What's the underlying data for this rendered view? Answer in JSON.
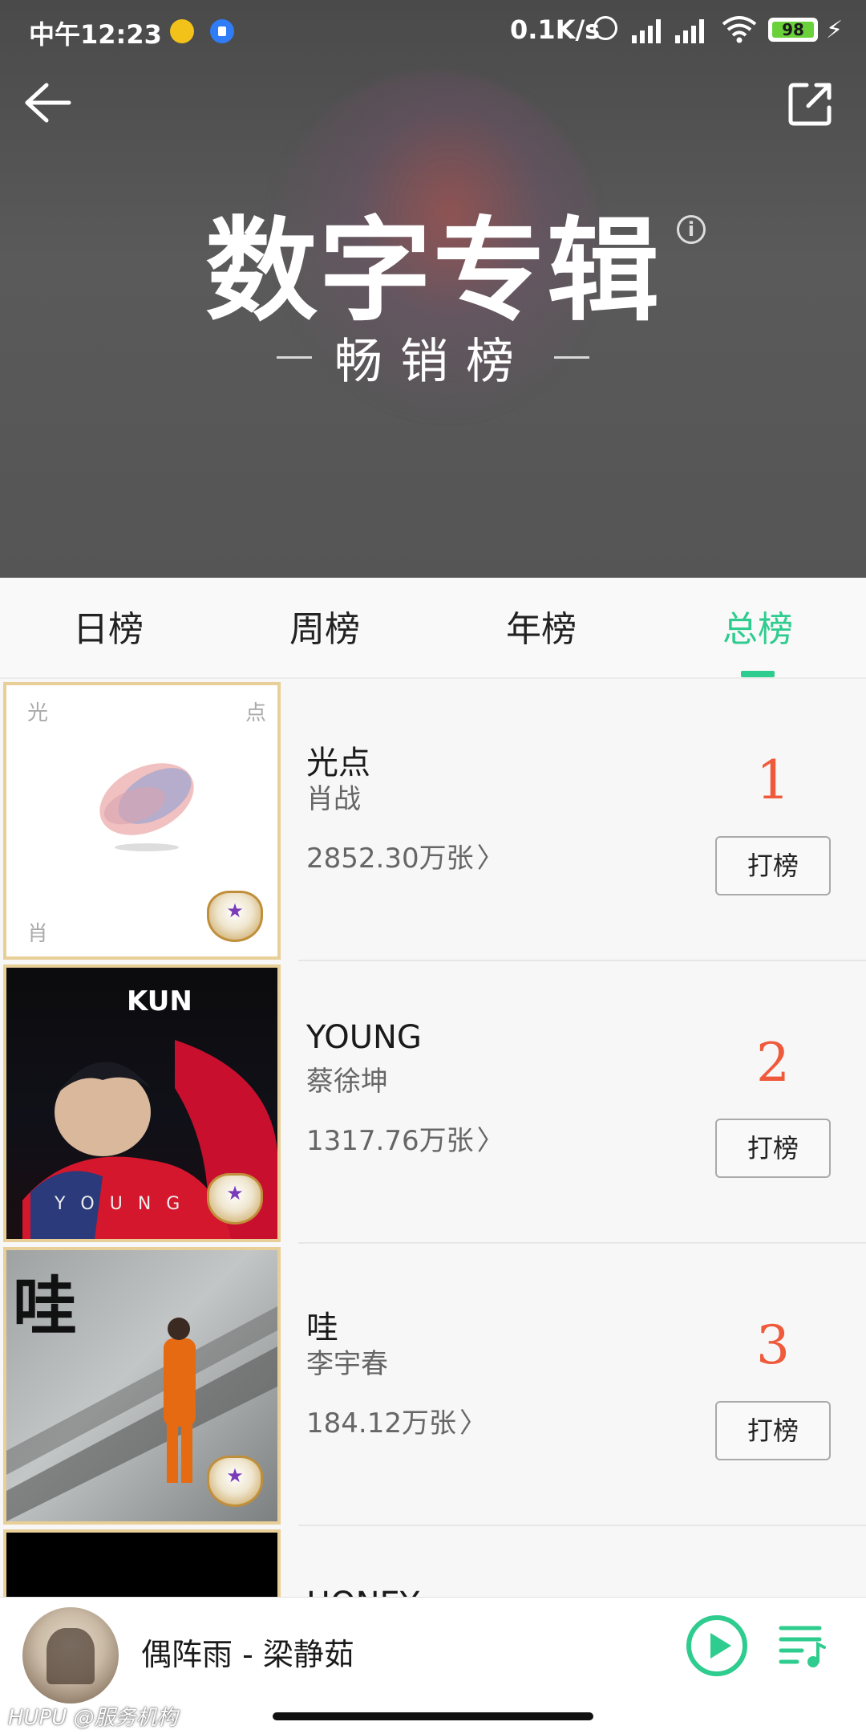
{
  "status": {
    "time": "中午12:23",
    "net_speed": "0.1K/s",
    "battery": "98"
  },
  "header": {
    "title": "数字专辑",
    "subtitle": "畅销榜",
    "info_symbol": "i"
  },
  "tabs": [
    {
      "label": "日榜",
      "active": false
    },
    {
      "label": "周榜",
      "active": false
    },
    {
      "label": "年榜",
      "active": false
    },
    {
      "label": "总榜",
      "active": true
    }
  ],
  "albums": [
    {
      "title": "光点",
      "artist": "肖战",
      "sales": "2852.30万张",
      "rank": "1",
      "button": "打榜",
      "cover_text": [
        "光",
        "点",
        "肖"
      ]
    },
    {
      "title": "YOUNG",
      "artist": "蔡徐坤",
      "sales": "1317.76万张",
      "rank": "2",
      "button": "打榜",
      "cover_text": [
        "KUN",
        "Y O U N G"
      ]
    },
    {
      "title": "哇",
      "artist": "李宇春",
      "sales": "184.12万张",
      "rank": "3",
      "button": "打榜",
      "cover_text": [
        "哇"
      ]
    },
    {
      "title": "HONEY",
      "artist": "",
      "sales": "",
      "rank": "",
      "button": "",
      "cover_text": []
    }
  ],
  "player": {
    "now_playing": "偶阵雨 - 梁静茹"
  },
  "watermark": "HUPU @服务机构",
  "colors": {
    "accent": "#2ecc8e",
    "rank": "#ef5a3c",
    "badge_border": "#e8cf98"
  },
  "icons": [
    "back-icon",
    "share-icon",
    "info-icon",
    "play-icon",
    "playlist-icon",
    "alarm-icon",
    "wifi-icon",
    "battery-icon"
  ]
}
